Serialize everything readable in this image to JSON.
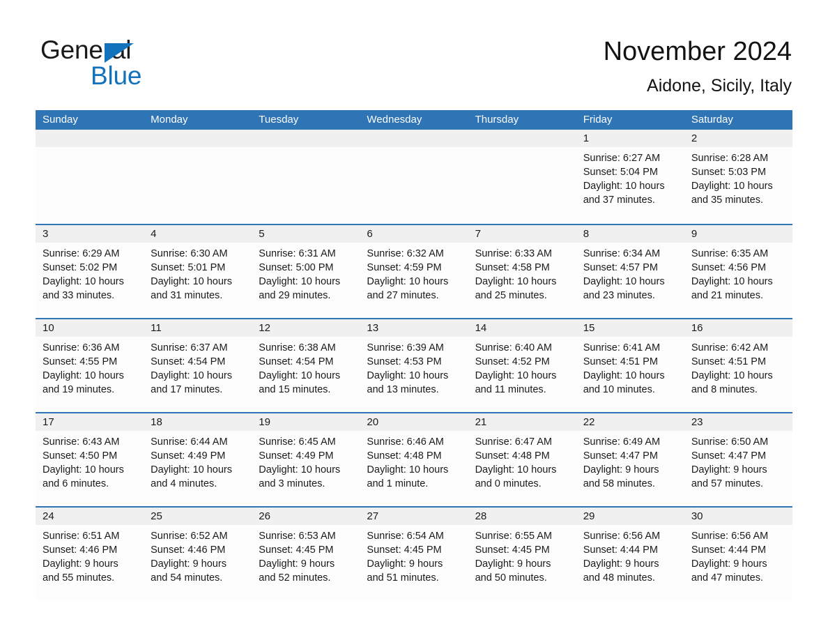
{
  "logo": {
    "word_one": "General",
    "word_two": "Blue",
    "triangle_color": "#1272bb",
    "text_color": "#1a1a1a"
  },
  "header": {
    "title": "November 2024",
    "subtitle": "Aidone, Sicily, Italy"
  },
  "colors": {
    "header_blue": "#2f74b5",
    "daynum_strip": "#f0f0f0",
    "cell_background": "#fdfdfd",
    "text": "#1a1a1a"
  },
  "weekday_headers": [
    "Sunday",
    "Monday",
    "Tuesday",
    "Wednesday",
    "Thursday",
    "Friday",
    "Saturday"
  ],
  "weeks": [
    [
      {
        "day": "",
        "sunrise": "",
        "sunset": "",
        "daylight_1": "",
        "daylight_2": ""
      },
      {
        "day": "",
        "sunrise": "",
        "sunset": "",
        "daylight_1": "",
        "daylight_2": ""
      },
      {
        "day": "",
        "sunrise": "",
        "sunset": "",
        "daylight_1": "",
        "daylight_2": ""
      },
      {
        "day": "",
        "sunrise": "",
        "sunset": "",
        "daylight_1": "",
        "daylight_2": ""
      },
      {
        "day": "",
        "sunrise": "",
        "sunset": "",
        "daylight_1": "",
        "daylight_2": ""
      },
      {
        "day": "1",
        "sunrise": "Sunrise: 6:27 AM",
        "sunset": "Sunset: 5:04 PM",
        "daylight_1": "Daylight: 10 hours",
        "daylight_2": "and 37 minutes."
      },
      {
        "day": "2",
        "sunrise": "Sunrise: 6:28 AM",
        "sunset": "Sunset: 5:03 PM",
        "daylight_1": "Daylight: 10 hours",
        "daylight_2": "and 35 minutes."
      }
    ],
    [
      {
        "day": "3",
        "sunrise": "Sunrise: 6:29 AM",
        "sunset": "Sunset: 5:02 PM",
        "daylight_1": "Daylight: 10 hours",
        "daylight_2": "and 33 minutes."
      },
      {
        "day": "4",
        "sunrise": "Sunrise: 6:30 AM",
        "sunset": "Sunset: 5:01 PM",
        "daylight_1": "Daylight: 10 hours",
        "daylight_2": "and 31 minutes."
      },
      {
        "day": "5",
        "sunrise": "Sunrise: 6:31 AM",
        "sunset": "Sunset: 5:00 PM",
        "daylight_1": "Daylight: 10 hours",
        "daylight_2": "and 29 minutes."
      },
      {
        "day": "6",
        "sunrise": "Sunrise: 6:32 AM",
        "sunset": "Sunset: 4:59 PM",
        "daylight_1": "Daylight: 10 hours",
        "daylight_2": "and 27 minutes."
      },
      {
        "day": "7",
        "sunrise": "Sunrise: 6:33 AM",
        "sunset": "Sunset: 4:58 PM",
        "daylight_1": "Daylight: 10 hours",
        "daylight_2": "and 25 minutes."
      },
      {
        "day": "8",
        "sunrise": "Sunrise: 6:34 AM",
        "sunset": "Sunset: 4:57 PM",
        "daylight_1": "Daylight: 10 hours",
        "daylight_2": "and 23 minutes."
      },
      {
        "day": "9",
        "sunrise": "Sunrise: 6:35 AM",
        "sunset": "Sunset: 4:56 PM",
        "daylight_1": "Daylight: 10 hours",
        "daylight_2": "and 21 minutes."
      }
    ],
    [
      {
        "day": "10",
        "sunrise": "Sunrise: 6:36 AM",
        "sunset": "Sunset: 4:55 PM",
        "daylight_1": "Daylight: 10 hours",
        "daylight_2": "and 19 minutes."
      },
      {
        "day": "11",
        "sunrise": "Sunrise: 6:37 AM",
        "sunset": "Sunset: 4:54 PM",
        "daylight_1": "Daylight: 10 hours",
        "daylight_2": "and 17 minutes."
      },
      {
        "day": "12",
        "sunrise": "Sunrise: 6:38 AM",
        "sunset": "Sunset: 4:54 PM",
        "daylight_1": "Daylight: 10 hours",
        "daylight_2": "and 15 minutes."
      },
      {
        "day": "13",
        "sunrise": "Sunrise: 6:39 AM",
        "sunset": "Sunset: 4:53 PM",
        "daylight_1": "Daylight: 10 hours",
        "daylight_2": "and 13 minutes."
      },
      {
        "day": "14",
        "sunrise": "Sunrise: 6:40 AM",
        "sunset": "Sunset: 4:52 PM",
        "daylight_1": "Daylight: 10 hours",
        "daylight_2": "and 11 minutes."
      },
      {
        "day": "15",
        "sunrise": "Sunrise: 6:41 AM",
        "sunset": "Sunset: 4:51 PM",
        "daylight_1": "Daylight: 10 hours",
        "daylight_2": "and 10 minutes."
      },
      {
        "day": "16",
        "sunrise": "Sunrise: 6:42 AM",
        "sunset": "Sunset: 4:51 PM",
        "daylight_1": "Daylight: 10 hours",
        "daylight_2": "and 8 minutes."
      }
    ],
    [
      {
        "day": "17",
        "sunrise": "Sunrise: 6:43 AM",
        "sunset": "Sunset: 4:50 PM",
        "daylight_1": "Daylight: 10 hours",
        "daylight_2": "and 6 minutes."
      },
      {
        "day": "18",
        "sunrise": "Sunrise: 6:44 AM",
        "sunset": "Sunset: 4:49 PM",
        "daylight_1": "Daylight: 10 hours",
        "daylight_2": "and 4 minutes."
      },
      {
        "day": "19",
        "sunrise": "Sunrise: 6:45 AM",
        "sunset": "Sunset: 4:49 PM",
        "daylight_1": "Daylight: 10 hours",
        "daylight_2": "and 3 minutes."
      },
      {
        "day": "20",
        "sunrise": "Sunrise: 6:46 AM",
        "sunset": "Sunset: 4:48 PM",
        "daylight_1": "Daylight: 10 hours",
        "daylight_2": "and 1 minute."
      },
      {
        "day": "21",
        "sunrise": "Sunrise: 6:47 AM",
        "sunset": "Sunset: 4:48 PM",
        "daylight_1": "Daylight: 10 hours",
        "daylight_2": "and 0 minutes."
      },
      {
        "day": "22",
        "sunrise": "Sunrise: 6:49 AM",
        "sunset": "Sunset: 4:47 PM",
        "daylight_1": "Daylight: 9 hours",
        "daylight_2": "and 58 minutes."
      },
      {
        "day": "23",
        "sunrise": "Sunrise: 6:50 AM",
        "sunset": "Sunset: 4:47 PM",
        "daylight_1": "Daylight: 9 hours",
        "daylight_2": "and 57 minutes."
      }
    ],
    [
      {
        "day": "24",
        "sunrise": "Sunrise: 6:51 AM",
        "sunset": "Sunset: 4:46 PM",
        "daylight_1": "Daylight: 9 hours",
        "daylight_2": "and 55 minutes."
      },
      {
        "day": "25",
        "sunrise": "Sunrise: 6:52 AM",
        "sunset": "Sunset: 4:46 PM",
        "daylight_1": "Daylight: 9 hours",
        "daylight_2": "and 54 minutes."
      },
      {
        "day": "26",
        "sunrise": "Sunrise: 6:53 AM",
        "sunset": "Sunset: 4:45 PM",
        "daylight_1": "Daylight: 9 hours",
        "daylight_2": "and 52 minutes."
      },
      {
        "day": "27",
        "sunrise": "Sunrise: 6:54 AM",
        "sunset": "Sunset: 4:45 PM",
        "daylight_1": "Daylight: 9 hours",
        "daylight_2": "and 51 minutes."
      },
      {
        "day": "28",
        "sunrise": "Sunrise: 6:55 AM",
        "sunset": "Sunset: 4:45 PM",
        "daylight_1": "Daylight: 9 hours",
        "daylight_2": "and 50 minutes."
      },
      {
        "day": "29",
        "sunrise": "Sunrise: 6:56 AM",
        "sunset": "Sunset: 4:44 PM",
        "daylight_1": "Daylight: 9 hours",
        "daylight_2": "and 48 minutes."
      },
      {
        "day": "30",
        "sunrise": "Sunrise: 6:56 AM",
        "sunset": "Sunset: 4:44 PM",
        "daylight_1": "Daylight: 9 hours",
        "daylight_2": "and 47 minutes."
      }
    ]
  ]
}
